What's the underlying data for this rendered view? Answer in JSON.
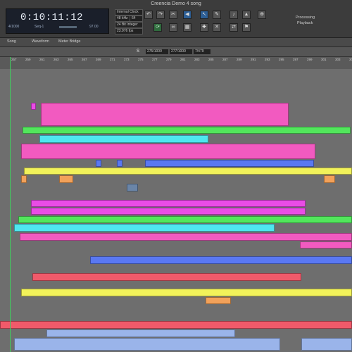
{
  "window": {
    "title": "Creencia Demo 4 song"
  },
  "transport": {
    "counter": "0:10:11:12",
    "position_small": "4/1000",
    "sequence": "Seq-1",
    "tempo": "97.00",
    "clock": "Internal Clock",
    "sample_rate": "48 kHz",
    "buffer": "64",
    "bit_depth": "24 Bit Integer",
    "frame_rate": "23.976 fps"
  },
  "status": {
    "line1": "Processing",
    "line2": "Playback"
  },
  "tabs": [
    "Song",
    "Waveform",
    "Meter Bridge"
  ],
  "locator": {
    "marker": "S",
    "start": "275/1000",
    "end": "277/1000",
    "length": "7/479"
  },
  "ruler": [
    "257",
    "259",
    "261",
    "263",
    "265",
    "267",
    "269",
    "271",
    "273",
    "275",
    "277",
    "279",
    "281",
    "283",
    "285",
    "287",
    "289",
    "291",
    "293",
    "295",
    "297",
    "299",
    "301",
    "303",
    "305",
    "307"
  ],
  "colors": {
    "pink": "#f25ac0",
    "magenta": "#e94ce6",
    "green": "#52e65c",
    "cyan": "#4fe6ef",
    "yellow": "#f2f25a",
    "orange": "#f2a15a",
    "blue": "#5a78f2",
    "red": "#f05a6a",
    "lightblue": "#9ab4ea"
  },
  "icons": [
    "undo-icon",
    "redo-icon",
    "scissors-icon",
    "speaker-icon",
    "arrow-tool-icon",
    "pencil-tool-icon",
    "link-icon",
    "crosshair-icon",
    "zoom-icon",
    "loop-icon",
    "grid-icon",
    "midi-icon",
    "metronome-icon"
  ]
}
